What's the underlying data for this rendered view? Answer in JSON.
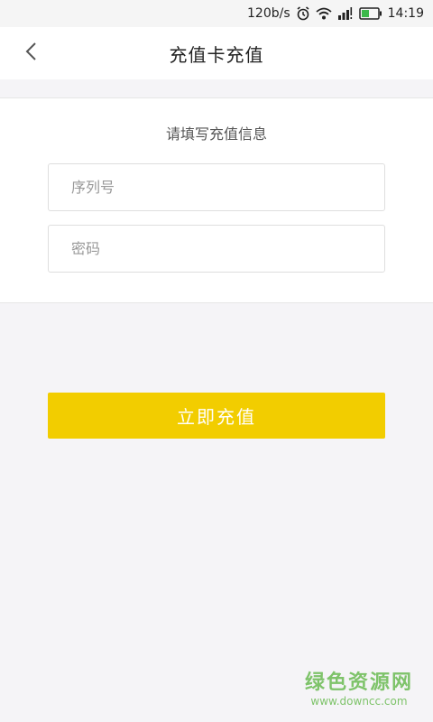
{
  "status_bar": {
    "speed": "120b/s",
    "time": "14:19",
    "icons": [
      "alarm-icon",
      "wifi-icon",
      "signal-icon",
      "battery-icon"
    ]
  },
  "header": {
    "title": "充值卡充值",
    "back_icon": "chevron-left-icon"
  },
  "form": {
    "heading": "请填写充值信息",
    "serial_placeholder": "序列号",
    "serial_value": "",
    "password_placeholder": "密码",
    "password_value": ""
  },
  "actions": {
    "submit_label": "立即充值"
  },
  "watermark": {
    "text": "绿色资源网",
    "url": "www.downcc.com"
  },
  "colors": {
    "accent": "#f2cd00",
    "background": "#f5f4f7",
    "watermark": "#7ec36a",
    "battery": "#3cb94a"
  }
}
